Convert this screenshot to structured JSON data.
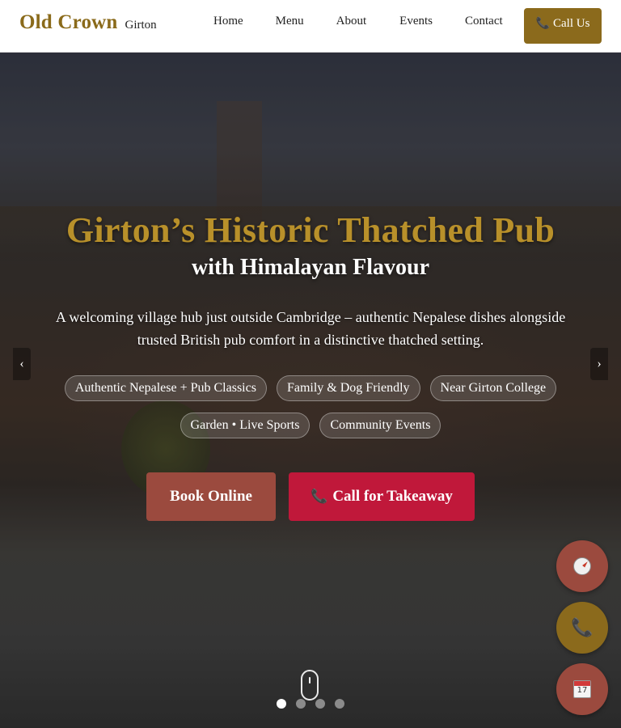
{
  "header": {
    "brand_name": "Old Crown",
    "brand_location": "Girton",
    "nav": [
      "Home",
      "Menu",
      "About",
      "Events",
      "Contact"
    ],
    "call_button": "Call Us"
  },
  "hero": {
    "title": "Girton’s Historic Thatched Pub",
    "subtitle": "with Himalayan Flavour",
    "lead": "A welcoming village hub just outside Cambridge – authentic Nepalese dishes alongside trusted British pub comfort in a distinctive thatched setting.",
    "tags_row1": [
      "Authentic Nepalese + Pub Classics",
      "Family & Dog Friendly",
      "Near Girton College"
    ],
    "tags_row2": [
      "Garden • Live Sports",
      "Community Events"
    ],
    "cta_book": "Book Online",
    "cta_takeaway": "Call for Takeaway",
    "prev_arrow": "‹",
    "next_arrow": "›",
    "slide_count": 4,
    "active_slide": 1
  },
  "floating_buttons": [
    "directions-compass-icon",
    "phone-icon",
    "calendar-icon"
  ],
  "colors": {
    "brand_gold": "#8b6a1c",
    "title_gold": "#b8902a",
    "book_red": "#9b4a3e",
    "takeaway_red": "#c0183a"
  }
}
